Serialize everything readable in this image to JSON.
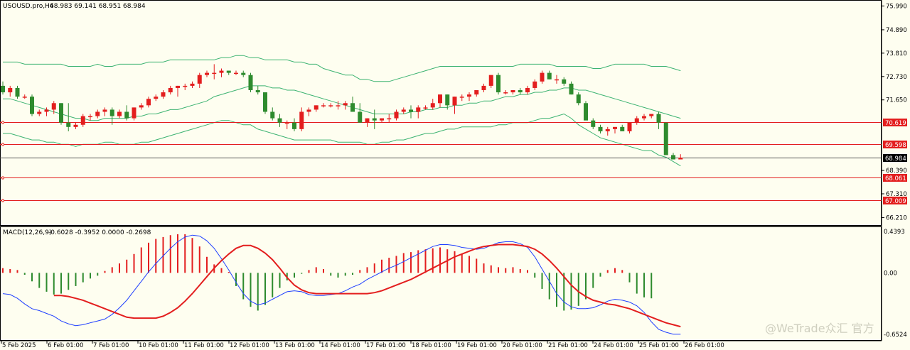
{
  "window": {
    "title": "USOUSD.pro,H4",
    "ohlc": "68.983 69.141 68.951 68.984"
  },
  "indicator": {
    "title": "MACD(12,26,9)",
    "values": "-0.6028 -0.3952 0.0000 -0.2698"
  },
  "watermark": "@WeTrade众汇 官方",
  "colors": {
    "background": "#fefef0",
    "bull_candle": "#e31e1e",
    "bear_candle": "#2e8b2e",
    "bands": "#3cb371",
    "level_line": "#e31e1e",
    "price_line": "#555555",
    "macd_main": "#1f3fff",
    "macd_signal": "#e31e1e",
    "hist_positive": "#e31e1e",
    "hist_negative": "#2e8b2e"
  },
  "price_axis": {
    "ticks": [
      "75.990",
      "74.890",
      "73.810",
      "72.730",
      "71.650",
      "68.390",
      "67.310",
      "66.210"
    ]
  },
  "level_labels": [
    {
      "label": "70.619",
      "value": 70.619
    },
    {
      "label": "69.598",
      "value": 69.598
    },
    {
      "label": "68.061",
      "value": 68.061
    },
    {
      "label": "67.009",
      "value": 67.009
    }
  ],
  "current_price": {
    "label": "68.984",
    "value": 68.984
  },
  "macd_axis": {
    "ticks": [
      "0.4393",
      "0.00",
      "-0.6524"
    ],
    "max": 0.4393,
    "min": -0.6524
  },
  "time_axis": [
    "5 Feb 2025",
    "6 Feb 01:00",
    "7 Feb 01:00",
    "10 Feb 01:00",
    "11 Feb 01:00",
    "12 Feb 01:00",
    "13 Feb 01:00",
    "14 Feb 01:00",
    "17 Feb 01:00",
    "18 Feb 01:00",
    "19 Feb 01:00",
    "20 Feb 01:00",
    "21 Feb 01:00",
    "24 Feb 01:00",
    "25 Feb 01:00",
    "26 Feb 01:00"
  ],
  "chart_data": {
    "type": "candlestick",
    "symbol": "USOUSD.pro",
    "timeframe": "H4",
    "y_range": [
      65.9,
      76.2
    ],
    "candles": [
      [
        72.3,
        72.5,
        71.9,
        72.0
      ],
      [
        72.0,
        72.3,
        71.8,
        72.2
      ],
      [
        72.2,
        72.3,
        71.7,
        71.8
      ],
      [
        71.8,
        71.9,
        71.7,
        71.8
      ],
      [
        71.8,
        71.9,
        70.9,
        71.0
      ],
      [
        71.0,
        71.2,
        70.9,
        71.1
      ],
      [
        71.1,
        71.3,
        70.9,
        71.2
      ],
      [
        71.2,
        71.6,
        71.0,
        71.5
      ],
      [
        71.5,
        71.5,
        70.5,
        70.6
      ],
      [
        70.6,
        71.5,
        70.2,
        70.4
      ],
      [
        70.4,
        70.6,
        70.3,
        70.5
      ],
      [
        70.5,
        71.0,
        70.4,
        70.9
      ],
      [
        70.9,
        71.0,
        70.7,
        70.9
      ],
      [
        70.9,
        71.2,
        70.8,
        71.1
      ],
      [
        71.1,
        71.3,
        70.9,
        71.2
      ],
      [
        71.2,
        71.3,
        70.5,
        70.9
      ],
      [
        70.9,
        71.2,
        70.8,
        71.1
      ],
      [
        71.1,
        71.4,
        70.7,
        70.8
      ],
      [
        70.8,
        71.3,
        70.7,
        71.3
      ],
      [
        71.3,
        71.5,
        71.2,
        71.4
      ],
      [
        71.4,
        71.8,
        71.3,
        71.7
      ],
      [
        71.7,
        71.9,
        71.6,
        71.8
      ],
      [
        71.8,
        72.1,
        71.7,
        72.0
      ],
      [
        72.0,
        72.3,
        71.9,
        72.2
      ],
      [
        72.2,
        72.3,
        71.8,
        72.3
      ],
      [
        72.3,
        72.4,
        72.1,
        72.3
      ],
      [
        72.3,
        72.5,
        72.2,
        72.4
      ],
      [
        72.4,
        72.9,
        72.2,
        72.8
      ],
      [
        72.8,
        73.0,
        72.7,
        72.9
      ],
      [
        72.9,
        73.3,
        72.6,
        72.9
      ],
      [
        72.9,
        73.1,
        72.7,
        73.0
      ],
      [
        73.0,
        73.0,
        72.8,
        72.9
      ],
      [
        72.9,
        73.0,
        72.8,
        72.9
      ],
      [
        72.9,
        73.0,
        72.7,
        72.8
      ],
      [
        72.8,
        72.9,
        72.0,
        72.1
      ],
      [
        72.1,
        72.3,
        71.9,
        72.0
      ],
      [
        72.0,
        72.0,
        71.0,
        71.1
      ],
      [
        71.1,
        71.3,
        70.7,
        70.8
      ],
      [
        70.8,
        71.0,
        70.4,
        70.6
      ],
      [
        70.6,
        70.7,
        70.3,
        70.6
      ],
      [
        70.6,
        70.8,
        70.2,
        70.3
      ],
      [
        70.3,
        71.3,
        70.2,
        71.1
      ],
      [
        71.1,
        71.3,
        70.9,
        71.2
      ],
      [
        71.2,
        71.4,
        71.1,
        71.4
      ],
      [
        71.4,
        71.5,
        71.3,
        71.4
      ],
      [
        71.4,
        71.5,
        71.3,
        71.4
      ],
      [
        71.4,
        71.6,
        71.2,
        71.4
      ],
      [
        71.4,
        71.6,
        71.2,
        71.5
      ],
      [
        71.5,
        71.8,
        71.3,
        71.1
      ],
      [
        71.1,
        71.5,
        70.9,
        70.6
      ],
      [
        70.6,
        70.8,
        70.4,
        70.8
      ],
      [
        70.8,
        71.2,
        70.3,
        70.7
      ],
      [
        70.7,
        70.8,
        70.6,
        70.8
      ],
      [
        70.8,
        71.0,
        70.6,
        70.8
      ],
      [
        70.8,
        71.2,
        70.7,
        71.1
      ],
      [
        71.1,
        71.3,
        71.0,
        71.2
      ],
      [
        71.2,
        71.4,
        70.8,
        71.1
      ],
      [
        71.1,
        71.4,
        70.8,
        71.3
      ],
      [
        71.3,
        71.4,
        71.2,
        71.3
      ],
      [
        71.3,
        71.7,
        71.2,
        71.5
      ],
      [
        71.5,
        71.9,
        71.3,
        71.9
      ],
      [
        71.9,
        71.9,
        71.2,
        71.4
      ],
      [
        71.4,
        71.8,
        71.0,
        71.8
      ],
      [
        71.8,
        71.9,
        71.6,
        71.8
      ],
      [
        71.8,
        72.0,
        71.6,
        71.9
      ],
      [
        71.9,
        72.1,
        71.8,
        72.1
      ],
      [
        72.1,
        72.4,
        72.0,
        72.3
      ],
      [
        72.3,
        72.8,
        72.2,
        72.8
      ],
      [
        72.8,
        72.9,
        71.9,
        72.0
      ],
      [
        72.0,
        72.1,
        71.9,
        72.0
      ],
      [
        72.0,
        72.1,
        71.9,
        72.1
      ],
      [
        72.1,
        72.2,
        71.9,
        72.0
      ],
      [
        72.0,
        72.3,
        71.9,
        72.2
      ],
      [
        72.2,
        72.6,
        72.1,
        72.5
      ],
      [
        72.5,
        73.0,
        72.4,
        72.9
      ],
      [
        72.9,
        73.0,
        72.6,
        72.6
      ],
      [
        72.6,
        72.8,
        72.4,
        72.6
      ],
      [
        72.6,
        72.7,
        72.3,
        72.4
      ],
      [
        72.4,
        72.5,
        71.9,
        71.9
      ],
      [
        71.9,
        72.0,
        71.4,
        71.5
      ],
      [
        71.5,
        71.6,
        70.8,
        70.7
      ],
      [
        70.7,
        70.8,
        70.3,
        70.4
      ],
      [
        70.4,
        70.5,
        70.1,
        70.2
      ],
      [
        70.2,
        70.4,
        70.0,
        70.3
      ],
      [
        70.3,
        70.4,
        70.1,
        70.4
      ],
      [
        70.4,
        70.5,
        70.3,
        70.2
      ],
      [
        70.2,
        70.6,
        70.1,
        70.6
      ],
      [
        70.6,
        70.9,
        70.5,
        70.8
      ],
      [
        70.8,
        71.0,
        70.7,
        70.9
      ],
      [
        70.9,
        71.0,
        70.8,
        71.0
      ],
      [
        71.0,
        71.1,
        70.3,
        70.6
      ],
      [
        70.6,
        70.6,
        69.3,
        69.1
      ],
      [
        69.1,
        69.2,
        68.9,
        68.9
      ],
      [
        68.9,
        69.141,
        68.951,
        68.984
      ]
    ],
    "bollinger": {
      "upper": [
        73.4,
        73.4,
        73.4,
        73.3,
        73.3,
        73.3,
        73.3,
        73.3,
        73.3,
        73.2,
        73.2,
        73.2,
        73.2,
        73.3,
        73.2,
        73.2,
        73.3,
        73.3,
        73.3,
        73.3,
        73.4,
        73.4,
        73.4,
        73.5,
        73.5,
        73.5,
        73.5,
        73.5,
        73.5,
        73.5,
        73.6,
        73.6,
        73.7,
        73.7,
        73.6,
        73.6,
        73.5,
        73.5,
        73.5,
        73.5,
        73.4,
        73.4,
        73.3,
        73.3,
        73.1,
        73.0,
        72.9,
        72.8,
        72.8,
        72.6,
        72.6,
        72.5,
        72.5,
        72.5,
        72.6,
        72.7,
        72.8,
        72.9,
        73.0,
        73.1,
        73.2,
        73.2,
        73.2,
        73.2,
        73.2,
        73.2,
        73.2,
        73.2,
        73.2,
        73.2,
        73.2,
        73.3,
        73.3,
        73.3,
        73.3,
        73.3,
        73.2,
        73.2,
        73.2,
        73.2,
        73.2,
        73.1,
        73.1,
        73.2,
        73.3,
        73.3,
        73.3,
        73.3,
        73.3,
        73.2,
        73.2,
        73.2,
        73.1,
        73.0
      ],
      "mid": [
        71.7,
        71.7,
        71.6,
        71.5,
        71.4,
        71.3,
        71.2,
        71.1,
        71.0,
        70.9,
        70.8,
        70.8,
        70.7,
        70.7,
        70.8,
        70.8,
        70.8,
        70.8,
        70.9,
        70.9,
        71.0,
        71.0,
        71.1,
        71.2,
        71.2,
        71.3,
        71.4,
        71.5,
        71.6,
        71.8,
        71.9,
        72.0,
        72.1,
        72.2,
        72.3,
        72.3,
        72.3,
        72.2,
        72.2,
        72.1,
        72.1,
        72.0,
        71.9,
        71.8,
        71.7,
        71.6,
        71.5,
        71.4,
        71.3,
        71.2,
        71.1,
        71.0,
        71.0,
        71.0,
        71.0,
        71.0,
        71.1,
        71.1,
        71.2,
        71.2,
        71.3,
        71.3,
        71.4,
        71.4,
        71.5,
        71.5,
        71.6,
        71.6,
        71.7,
        71.8,
        71.8,
        71.9,
        71.9,
        72.0,
        72.0,
        72.1,
        72.1,
        72.2,
        72.2,
        72.1,
        72.1,
        72.0,
        71.9,
        71.8,
        71.7,
        71.6,
        71.5,
        71.4,
        71.3,
        71.2,
        71.1,
        71.0,
        70.9,
        70.8
      ],
      "lower": [
        70.1,
        70.1,
        70.0,
        69.9,
        69.8,
        69.8,
        69.7,
        69.7,
        69.6,
        69.6,
        69.5,
        69.6,
        69.6,
        69.6,
        69.7,
        69.7,
        69.6,
        69.6,
        69.6,
        69.7,
        69.7,
        69.8,
        69.9,
        70.0,
        70.1,
        70.2,
        70.3,
        70.4,
        70.5,
        70.6,
        70.7,
        70.7,
        70.6,
        70.5,
        70.5,
        70.3,
        70.2,
        70.1,
        70.0,
        69.9,
        69.8,
        69.8,
        69.8,
        69.8,
        69.8,
        69.8,
        69.7,
        69.7,
        69.7,
        69.7,
        69.6,
        69.6,
        69.7,
        69.7,
        69.8,
        69.8,
        69.9,
        70.0,
        70.1,
        70.1,
        70.2,
        70.3,
        70.3,
        70.4,
        70.4,
        70.4,
        70.4,
        70.4,
        70.5,
        70.5,
        70.6,
        70.6,
        70.6,
        70.7,
        70.8,
        70.8,
        70.9,
        71.0,
        70.8,
        70.5,
        70.3,
        70.1,
        69.9,
        69.8,
        69.7,
        69.6,
        69.5,
        69.4,
        69.3,
        69.3,
        69.1,
        69.0,
        68.8,
        68.6
      ]
    },
    "levels": [
      70.619,
      69.598,
      68.061,
      67.009
    ],
    "macd": {
      "main": [
        -0.22,
        -0.23,
        -0.27,
        -0.33,
        -0.38,
        -0.4,
        -0.43,
        -0.46,
        -0.51,
        -0.54,
        -0.56,
        -0.55,
        -0.53,
        -0.51,
        -0.49,
        -0.44,
        -0.37,
        -0.29,
        -0.19,
        -0.09,
        0.01,
        0.1,
        0.18,
        0.26,
        0.33,
        0.38,
        0.4,
        0.39,
        0.34,
        0.26,
        0.15,
        0.03,
        -0.1,
        -0.22,
        -0.3,
        -0.34,
        -0.32,
        -0.28,
        -0.24,
        -0.2,
        -0.19,
        -0.2,
        -0.23,
        -0.24,
        -0.24,
        -0.23,
        -0.22,
        -0.19,
        -0.15,
        -0.12,
        -0.07,
        -0.03,
        0.01,
        0.05,
        0.08,
        0.12,
        0.16,
        0.2,
        0.24,
        0.28,
        0.3,
        0.3,
        0.29,
        0.27,
        0.26,
        0.25,
        0.26,
        0.29,
        0.32,
        0.33,
        0.33,
        0.31,
        0.27,
        0.17,
        0.04,
        -0.09,
        -0.22,
        -0.31,
        -0.36,
        -0.38,
        -0.38,
        -0.37,
        -0.34,
        -0.3,
        -0.28,
        -0.29,
        -0.31,
        -0.35,
        -0.42,
        -0.52,
        -0.6,
        -0.63,
        -0.65,
        -0.65
      ],
      "signal": [
        -0.24,
        -0.24,
        -0.25,
        -0.27,
        -0.29,
        -0.32,
        -0.35,
        -0.38,
        -0.41,
        -0.44,
        -0.47,
        -0.48,
        -0.48,
        -0.48,
        -0.48,
        -0.46,
        -0.42,
        -0.37,
        -0.3,
        -0.22,
        -0.13,
        -0.04,
        0.05,
        0.13,
        0.2,
        0.26,
        0.29,
        0.29,
        0.26,
        0.21,
        0.14,
        0.05,
        -0.05,
        -0.13,
        -0.18,
        -0.21,
        -0.22,
        -0.22,
        -0.22,
        -0.22,
        -0.22,
        -0.22,
        -0.22,
        -0.22,
        -0.21,
        -0.19,
        -0.16,
        -0.13,
        -0.1,
        -0.07,
        -0.03,
        0.01,
        0.05,
        0.09,
        0.13,
        0.17,
        0.2,
        0.23,
        0.26,
        0.28,
        0.29,
        0.3,
        0.3,
        0.3,
        0.29,
        0.28,
        0.25,
        0.2,
        0.13,
        0.05,
        -0.04,
        -0.13,
        -0.2,
        -0.25,
        -0.29,
        -0.31,
        -0.33,
        -0.34,
        -0.36,
        -0.38,
        -0.41,
        -0.44,
        -0.47,
        -0.5,
        -0.53,
        -0.55,
        -0.57
      ],
      "histogram": [
        0.05,
        0.04,
        0.03,
        -0.02,
        -0.09,
        -0.16,
        -0.2,
        -0.23,
        -0.22,
        -0.18,
        -0.14,
        -0.1,
        -0.06,
        -0.03,
        0.02,
        0.06,
        0.1,
        0.14,
        0.2,
        0.27,
        0.32,
        0.36,
        0.38,
        0.4,
        0.41,
        0.41,
        0.37,
        0.28,
        0.17,
        0.09,
        0.05,
        0.01,
        -0.14,
        -0.28,
        -0.36,
        -0.4,
        -0.34,
        -0.26,
        -0.16,
        -0.08,
        -0.05,
        -0.01,
        0.03,
        0.06,
        0.04,
        -0.03,
        -0.05,
        -0.03,
        -0.02,
        0.03,
        0.06,
        0.1,
        0.14,
        0.16,
        0.18,
        0.21,
        0.22,
        0.24,
        0.25,
        0.26,
        0.27,
        0.25,
        0.23,
        0.2,
        0.18,
        0.15,
        0.1,
        0.08,
        0.06,
        0.05,
        0.06,
        0.04,
        0.03,
        -0.05,
        -0.17,
        -0.28,
        -0.36,
        -0.4,
        -0.39,
        -0.35,
        -0.28,
        -0.16,
        -0.04,
        0.03,
        0.05,
        0.03,
        -0.1,
        -0.22,
        -0.26,
        -0.27
      ]
    }
  }
}
